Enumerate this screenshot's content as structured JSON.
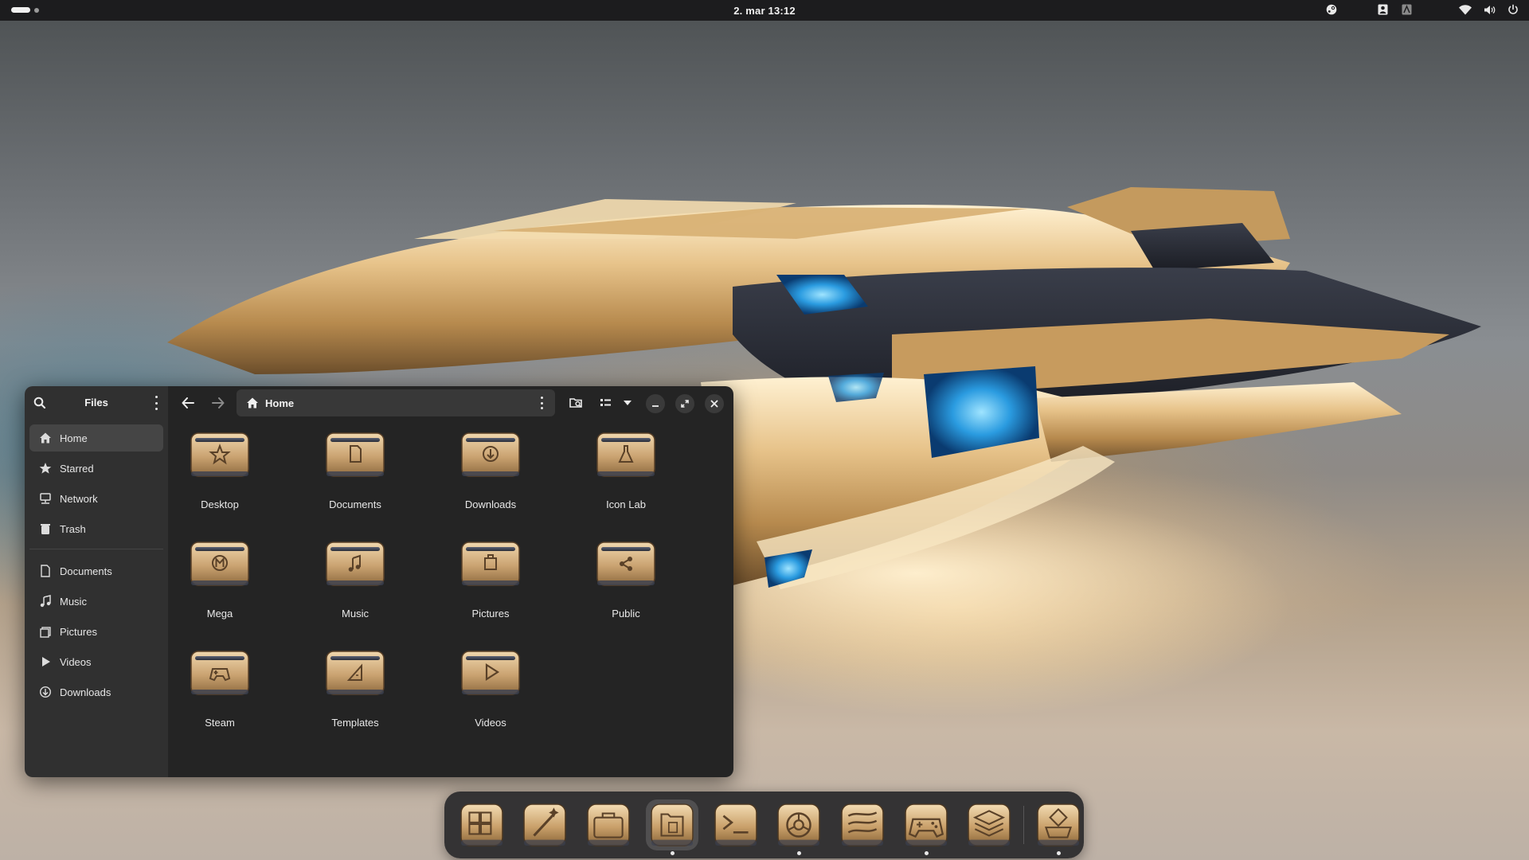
{
  "topbar": {
    "clock": "2. mar  13:12",
    "tray_icons": [
      "steam-icon",
      "user-icon",
      "user-alt-icon",
      "wifi-icon",
      "volume-icon",
      "power-icon"
    ]
  },
  "files": {
    "app_title": "Files",
    "location": "Home",
    "sidebar": {
      "places": [
        {
          "label": "Home",
          "icon": "home-icon",
          "active": true
        },
        {
          "label": "Starred",
          "icon": "star-icon"
        },
        {
          "label": "Network",
          "icon": "network-icon"
        },
        {
          "label": "Trash",
          "icon": "trash-icon"
        }
      ],
      "bookmarks": [
        {
          "label": "Documents",
          "icon": "document-icon"
        },
        {
          "label": "Music",
          "icon": "music-icon"
        },
        {
          "label": "Pictures",
          "icon": "pictures-icon"
        },
        {
          "label": "Videos",
          "icon": "videos-icon"
        },
        {
          "label": "Downloads",
          "icon": "downloads-icon"
        }
      ]
    },
    "folders": [
      {
        "label": "Desktop",
        "glyph": "star"
      },
      {
        "label": "Documents",
        "glyph": "doc"
      },
      {
        "label": "Downloads",
        "glyph": "download"
      },
      {
        "label": "Icon Lab",
        "glyph": "flask"
      },
      {
        "label": "Mega",
        "glyph": "mega"
      },
      {
        "label": "Music",
        "glyph": "music"
      },
      {
        "label": "Pictures",
        "glyph": "picture"
      },
      {
        "label": "Public",
        "glyph": "share"
      },
      {
        "label": "Steam",
        "glyph": "gamepad"
      },
      {
        "label": "Templates",
        "glyph": "ruler"
      },
      {
        "label": "Videos",
        "glyph": "play"
      }
    ]
  },
  "dock": {
    "items": [
      {
        "name": "app-grid-icon",
        "running": false
      },
      {
        "name": "magic-wand-icon",
        "running": false
      },
      {
        "name": "briefcase-icon",
        "running": false
      },
      {
        "name": "files-icon",
        "running": true,
        "active": true
      },
      {
        "name": "terminal-icon",
        "running": false
      },
      {
        "name": "browser-icon",
        "running": true
      },
      {
        "name": "waves-icon",
        "running": false
      },
      {
        "name": "gamepad-icon",
        "running": true
      },
      {
        "name": "layers-icon",
        "running": false
      },
      {
        "name": "settings-bot-icon",
        "running": true
      }
    ]
  },
  "colors": {
    "gold": "#c9a675",
    "gold_dark": "#8a6a40",
    "sidebar_bg": "#303030",
    "main_bg": "#242424",
    "topbar_bg": "#1c1c1e"
  }
}
